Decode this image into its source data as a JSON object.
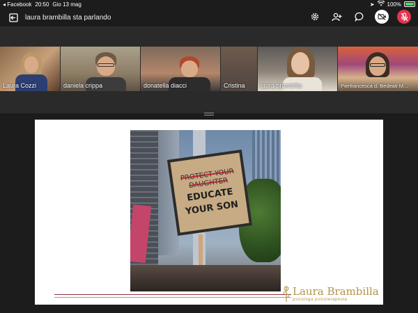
{
  "status_bar": {
    "back_app": "◂ Facebook",
    "time": "20:50",
    "date": "Gio 13 mag",
    "battery": "100%"
  },
  "header": {
    "speaker_title": "laura brambilla sta parlando"
  },
  "icons": {
    "back": "exit-icon",
    "settings": "gear-icon",
    "participants": "people-icon",
    "chat": "chat-bubble-icon",
    "video": "video-off-icon",
    "mic": "mic-off-icon"
  },
  "colors": {
    "mic_active_bg": "#e5344f",
    "video_btn_bg": "#ffffff",
    "brand_gold": "#b3924a",
    "rule_red": "#8b2f3b"
  },
  "participants": [
    {
      "name": "Laura Cozzi"
    },
    {
      "name": "daniela crippa"
    },
    {
      "name": "donatella diacci"
    },
    {
      "name": "Cristina"
    },
    {
      "name": "laura brambilla"
    },
    {
      "name": "Pierfrancesca d. Bedeati M..."
    }
  ],
  "slide": {
    "sign_crossed_line1": "PROTECT YOUR",
    "sign_crossed_line2": "DAUGHTER",
    "sign_line1": "EDUCATE",
    "sign_line2": "YOUR SON",
    "brand_name": "Laura Brambilla",
    "brand_subtitle": "psicologa psicoterapeuta"
  }
}
